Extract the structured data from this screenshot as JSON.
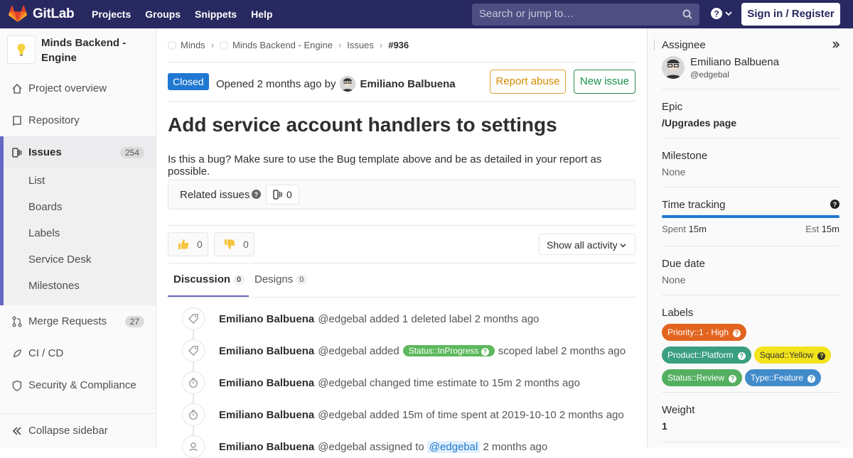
{
  "nav": {
    "logo_text": "GitLab",
    "links": [
      "Projects",
      "Groups",
      "Snippets",
      "Help"
    ],
    "search_placeholder": "Search or jump to…",
    "signin": "Sign in / Register"
  },
  "sidebar": {
    "project_name": "Minds Backend - Engine",
    "items": [
      {
        "label": "Project overview"
      },
      {
        "label": "Repository"
      },
      {
        "label": "Issues",
        "count": "254"
      },
      {
        "label": "Merge Requests",
        "count": "27"
      },
      {
        "label": "CI / CD"
      },
      {
        "label": "Security & Compliance"
      }
    ],
    "sub_items": [
      "List",
      "Boards",
      "Labels",
      "Service Desk",
      "Milestones"
    ],
    "collapse": "Collapse sidebar"
  },
  "breadcrumb": [
    "Minds",
    "Minds Backend - Engine",
    "Issues",
    "#936"
  ],
  "issue": {
    "status": "Closed",
    "opened_text": "Opened 2 months ago by",
    "author": "Emiliano Balbuena",
    "report_abuse": "Report abuse",
    "new_issue": "New issue",
    "title": "Add service account handlers to settings",
    "description": "Is this a bug? Make sure to use the Bug template above and be as detailed in your report as possible.",
    "related_label": "Related issues",
    "related_count": "0",
    "thumbs_up": "0",
    "thumbs_down": "0",
    "activity_filter": "Show all activity",
    "tabs": [
      {
        "label": "Discussion",
        "count": "0"
      },
      {
        "label": "Designs",
        "count": "0"
      }
    ]
  },
  "notes": [
    {
      "author": "Emiliano Balbuena",
      "text": "@edgebal added 1 deleted label 2 months ago",
      "icon": "tag-icon"
    },
    {
      "author": "Emiliano Balbuena",
      "pre": "@edgebal added",
      "pill": "Status::InProgress",
      "post": "scoped label 2 months ago",
      "icon": "tag-icon"
    },
    {
      "author": "Emiliano Balbuena",
      "text": "@edgebal changed time estimate to 15m 2 months ago",
      "icon": "timer-icon"
    },
    {
      "author": "Emiliano Balbuena",
      "text": "@edgebal added 15m of time spent at 2019-10-10 2 months ago",
      "icon": "timer-icon"
    },
    {
      "author": "Emiliano Balbuena",
      "pre": "@edgebal assigned to",
      "mention": "@edgebal",
      "post": "2 months ago",
      "icon": "user-icon"
    }
  ],
  "right": {
    "assignee_label": "Assignee",
    "assignee_name": "Emiliano Balbuena",
    "assignee_handle": "@edgebal",
    "epic_label": "Epic",
    "epic_value": "/Upgrades page",
    "milestone_label": "Milestone",
    "milestone_value": "None",
    "time_label": "Time tracking",
    "spent_label": "Spent",
    "spent_value": "15m",
    "est_label": "Est",
    "est_value": "15m",
    "time_progress": 1.0,
    "due_label": "Due date",
    "due_value": "None",
    "labels_label": "Labels",
    "labels": [
      {
        "text": "Priority::1 - High",
        "bg": "#e2641e",
        "fg": "#ffffff"
      },
      {
        "text": "Product::Platform",
        "bg": "#3a9e80",
        "fg": "#ffffff"
      },
      {
        "text": "Squad::Yellow",
        "bg": "#f3e31b",
        "fg": "#333333"
      },
      {
        "text": "Status::Review",
        "bg": "#54b060",
        "fg": "#ffffff"
      },
      {
        "text": "Type::Feature",
        "bg": "#428bca",
        "fg": "#ffffff"
      }
    ],
    "weight_label": "Weight",
    "weight_value": "1"
  },
  "colors": {
    "nav": "#292961",
    "accent": "#6666c4",
    "closed": "#1f78d1"
  }
}
